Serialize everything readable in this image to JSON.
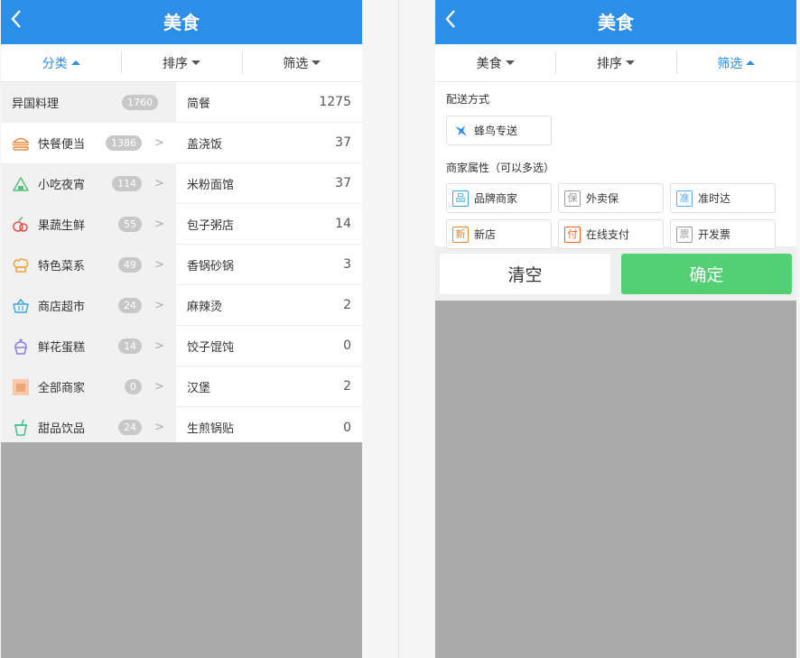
{
  "left_panel": {
    "header": {
      "title": "美食"
    },
    "tabs": [
      {
        "label": "分类",
        "active": true
      },
      {
        "label": "排序",
        "active": false
      },
      {
        "label": "筛选",
        "active": false
      }
    ],
    "categories": [
      {
        "label": "异国料理",
        "count": "1760",
        "icon": "none"
      },
      {
        "label": "快餐便当",
        "count": "1386",
        "icon": "burger-icon"
      },
      {
        "label": "小吃夜宵",
        "count": "114",
        "icon": "onigiri-icon"
      },
      {
        "label": "果蔬生鲜",
        "count": "55",
        "icon": "fruit-icon"
      },
      {
        "label": "特色菜系",
        "count": "49",
        "icon": "chef-hat-icon"
      },
      {
        "label": "商店超市",
        "count": "24",
        "icon": "basket-icon"
      },
      {
        "label": "鲜花蛋糕",
        "count": "14",
        "icon": "cupcake-icon"
      },
      {
        "label": "全部商家",
        "count": "0",
        "icon": "shop-icon"
      },
      {
        "label": "甜品饮品",
        "count": "24",
        "icon": "drink-icon"
      }
    ],
    "chevron": ">",
    "subcategories": [
      {
        "label": "简餐",
        "count": "1275"
      },
      {
        "label": "盖浇饭",
        "count": "37"
      },
      {
        "label": "米粉面馆",
        "count": "37"
      },
      {
        "label": "包子粥店",
        "count": "14"
      },
      {
        "label": "香锅砂锅",
        "count": "3"
      },
      {
        "label": "麻辣烫",
        "count": "2"
      },
      {
        "label": "饺子馄饨",
        "count": "0"
      },
      {
        "label": "汉堡",
        "count": "2"
      },
      {
        "label": "生煎锅贴",
        "count": "0"
      }
    ]
  },
  "right_panel": {
    "header": {
      "title": "美食"
    },
    "tabs": [
      {
        "label": "美食",
        "active": false
      },
      {
        "label": "排序",
        "active": false
      },
      {
        "label": "筛选",
        "active": true
      }
    ],
    "delivery_section": {
      "title": "配送方式",
      "option": {
        "label": "蜂鸟专送",
        "icon": "hummingbird-icon"
      }
    },
    "attribute_section": {
      "title": "商家属性（可以多选）",
      "options": [
        {
          "glyph": "品",
          "label": "品牌商家",
          "color": "#3aa8d8"
        },
        {
          "glyph": "保",
          "label": "外卖保",
          "color": "#999999"
        },
        {
          "glyph": "准",
          "label": "准时达",
          "color": "#57a9f6"
        },
        {
          "glyph": "新",
          "label": "新店",
          "color": "#e8842c"
        },
        {
          "glyph": "付",
          "label": "在线支付",
          "color": "#ff5c1a"
        },
        {
          "glyph": "票",
          "label": "开发票",
          "color": "#999999"
        }
      ]
    },
    "buttons": {
      "clear": "清空",
      "confirm": "确定"
    }
  },
  "colors": {
    "header_bg": "#2b8ee8",
    "confirm_bg": "#52d073",
    "overlay_bg": "#aaaaaa"
  }
}
